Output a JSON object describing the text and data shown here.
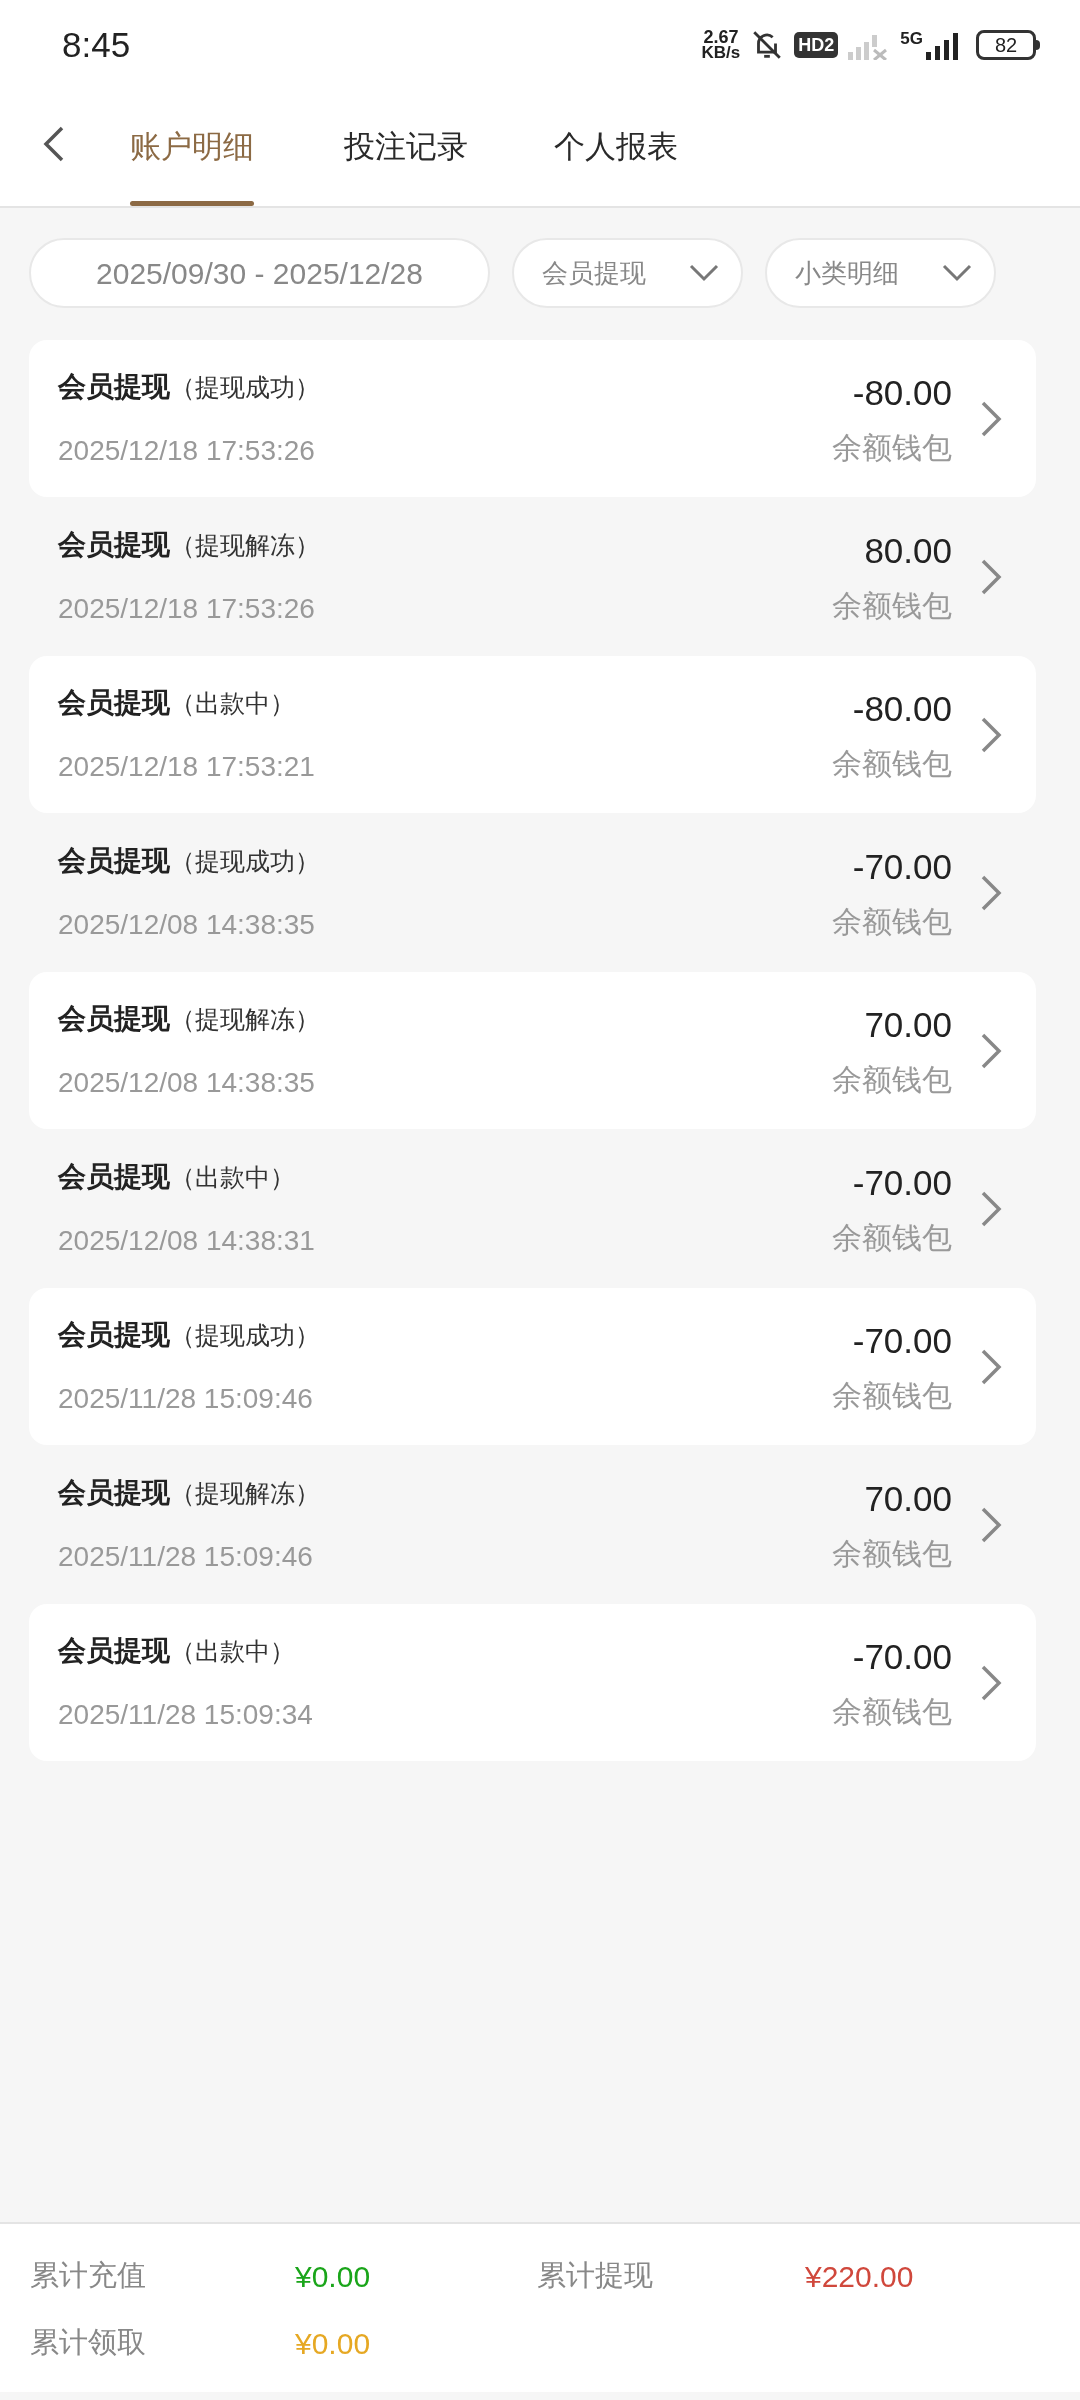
{
  "status_bar": {
    "time": "8:45",
    "net_speed": "2.67",
    "net_unit": "KB/s",
    "hd_badge": "HD2",
    "network": "5G",
    "battery": "82"
  },
  "tabs": [
    {
      "label": "账户明细",
      "selected": true
    },
    {
      "label": "投注记录",
      "selected": false
    },
    {
      "label": "个人报表",
      "selected": false
    }
  ],
  "filters": {
    "date_range": "2025/09/30 - 2025/12/28",
    "type": "会员提现",
    "detail": "小类明细"
  },
  "records": [
    {
      "title": "会员提现",
      "status": "（提现成功）",
      "time": "2025/12/18 17:53:26",
      "amount": "-80.00",
      "wallet": "余额钱包"
    },
    {
      "title": "会员提现",
      "status": "（提现解冻）",
      "time": "2025/12/18 17:53:26",
      "amount": "80.00",
      "wallet": "余额钱包"
    },
    {
      "title": "会员提现",
      "status": "（出款中）",
      "time": "2025/12/18 17:53:21",
      "amount": "-80.00",
      "wallet": "余额钱包"
    },
    {
      "title": "会员提现",
      "status": "（提现成功）",
      "time": "2025/12/08 14:38:35",
      "amount": "-70.00",
      "wallet": "余额钱包"
    },
    {
      "title": "会员提现",
      "status": "（提现解冻）",
      "time": "2025/12/08 14:38:35",
      "amount": "70.00",
      "wallet": "余额钱包"
    },
    {
      "title": "会员提现",
      "status": "（出款中）",
      "time": "2025/12/08 14:38:31",
      "amount": "-70.00",
      "wallet": "余额钱包"
    },
    {
      "title": "会员提现",
      "status": "（提现成功）",
      "time": "2025/11/28 15:09:46",
      "amount": "-70.00",
      "wallet": "余额钱包"
    },
    {
      "title": "会员提现",
      "status": "（提现解冻）",
      "time": "2025/11/28 15:09:46",
      "amount": "70.00",
      "wallet": "余额钱包"
    },
    {
      "title": "会员提现",
      "status": "（出款中）",
      "time": "2025/11/28 15:09:34",
      "amount": "-70.00",
      "wallet": "余额钱包"
    }
  ],
  "summary": [
    {
      "label": "累计充值",
      "value": "¥0.00",
      "color": "#1aa51a"
    },
    {
      "label": "累计提现",
      "value": "¥220.00",
      "color": "#d0483c"
    },
    {
      "label": "累计领取",
      "value": "¥0.00",
      "color": "#e6a823"
    }
  ]
}
